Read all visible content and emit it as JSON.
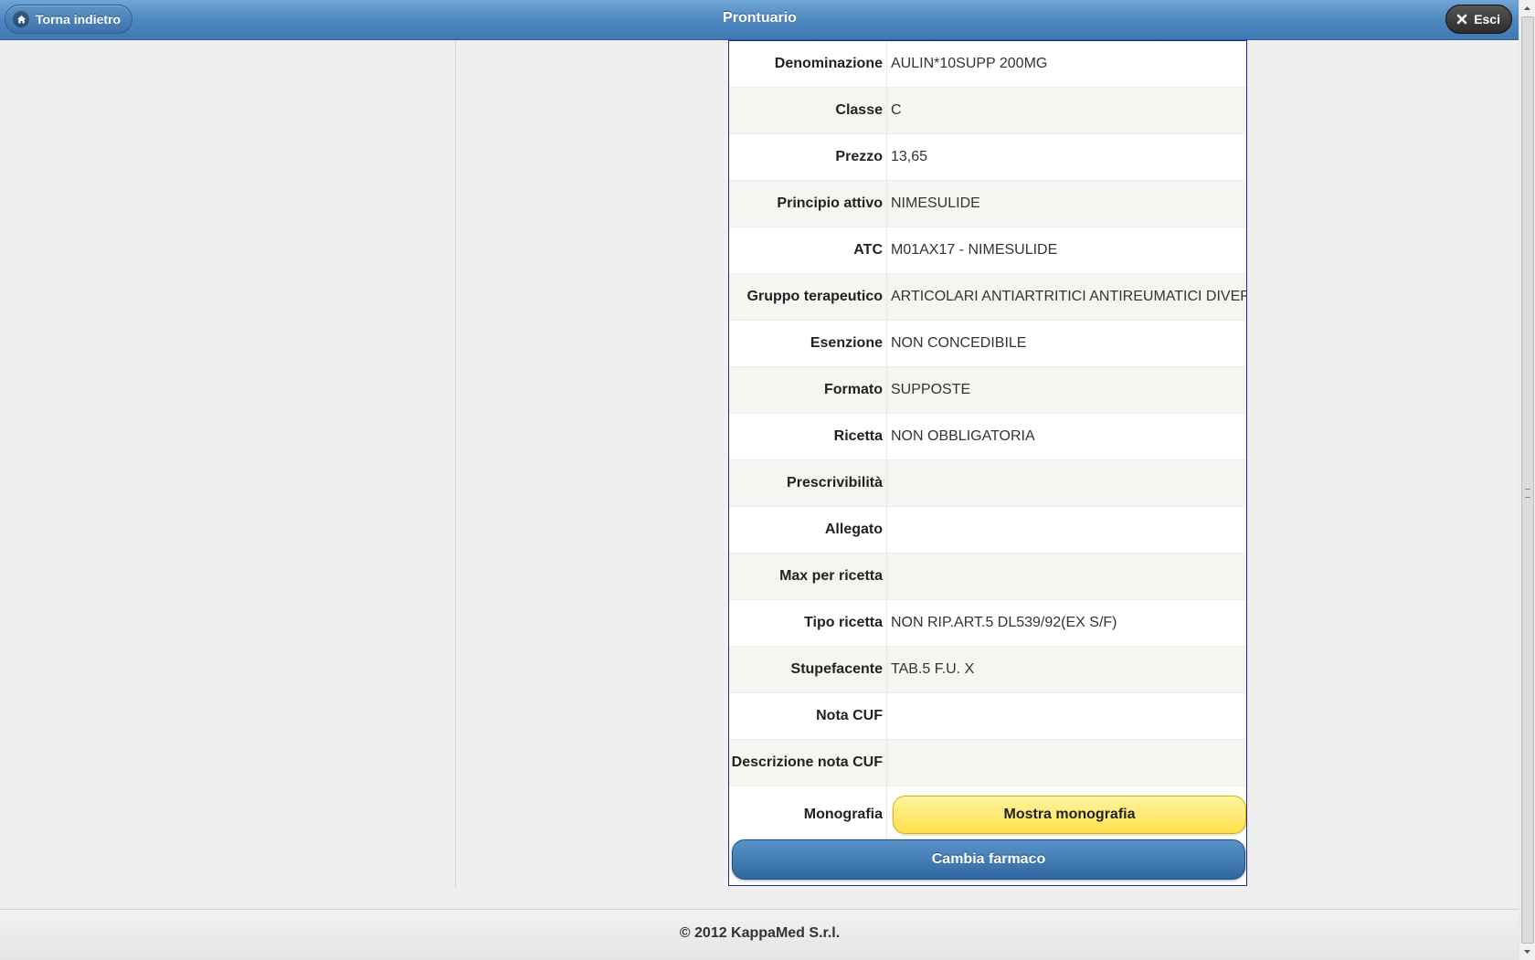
{
  "header": {
    "title": "Prontuario",
    "back_label": "Torna indietro",
    "exit_label": "Esci"
  },
  "details": {
    "rows": [
      {
        "label": "Denominazione",
        "value": "AULIN*10SUPP 200MG"
      },
      {
        "label": "Classe",
        "value": "C"
      },
      {
        "label": "Prezzo",
        "value": "13,65"
      },
      {
        "label": "Principio attivo",
        "value": "NIMESULIDE"
      },
      {
        "label": "ATC",
        "value": "M01AX17 - NIMESULIDE"
      },
      {
        "label": "Gruppo terapeutico",
        "value": "ARTICOLARI ANTIARTRITICI ANTIREUMATICI DIVERSI"
      },
      {
        "label": "Esenzione",
        "value": "NON CONCEDIBILE"
      },
      {
        "label": "Formato",
        "value": "SUPPOSTE"
      },
      {
        "label": "Ricetta",
        "value": "NON OBBLIGATORIA"
      },
      {
        "label": "Prescrivibilità",
        "value": ""
      },
      {
        "label": "Allegato",
        "value": ""
      },
      {
        "label": "Max per ricetta",
        "value": ""
      },
      {
        "label": "Tipo ricetta",
        "value": "NON RIP.ART.5 DL539/92(EX S/F)"
      },
      {
        "label": "Stupefacente",
        "value": "TAB.5 F.U. X"
      },
      {
        "label": "Nota CUF",
        "value": ""
      },
      {
        "label": "Descrizione nota CUF",
        "value": ""
      }
    ],
    "monografia_label": "Monografia",
    "monografia_button": "Mostra monografia",
    "change_button": "Cambia farmaco"
  },
  "footer": {
    "copyright": "© 2012 KappaMed S.r.l."
  },
  "icons": {
    "back": "home-icon",
    "exit": "close-icon"
  },
  "colors": {
    "header": "#4f88c0",
    "monografia_button": "#ffe14b",
    "change_button": "#3c72a8",
    "card_border": "#1f2b8c"
  }
}
